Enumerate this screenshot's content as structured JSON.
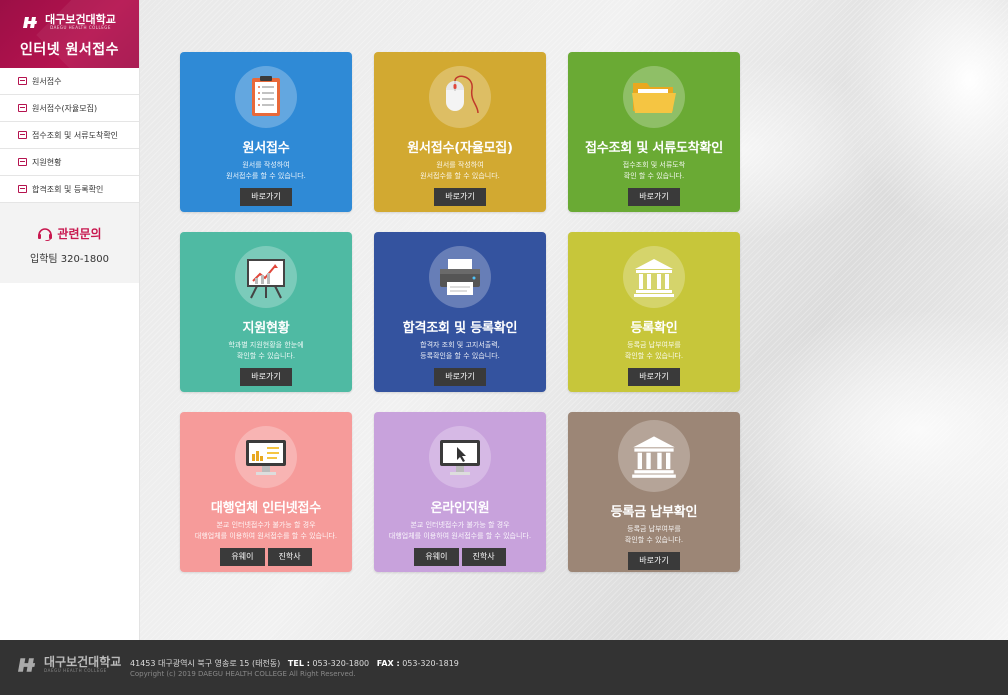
{
  "sidebar": {
    "logo_text": "대구보건대학교",
    "logo_sub": "DAEGU HEALTH COLLEGE",
    "title": "인터넷 원서접수",
    "menu": [
      {
        "label": "원서접수"
      },
      {
        "label": "원서접수(자율모집)"
      },
      {
        "label": "접수조회 및 서류도착확인"
      },
      {
        "label": "지원현황"
      },
      {
        "label": "합격조회 및 등록확인"
      }
    ],
    "contact_title": "관련문의",
    "contact_phone": "입학팀 320-1800"
  },
  "cards": [
    {
      "title": "원서접수",
      "desc1": "원서를 작성하여",
      "desc2": "원서접수를 할 수 있습니다.",
      "button": "바로가기",
      "color": "#2f8ad6",
      "icon": "clipboard-icon"
    },
    {
      "title": "원서접수(자율모집)",
      "desc1": "원서를 작성하여",
      "desc2": "원서접수를 할 수 있습니다.",
      "button": "바로가기",
      "color": "#d2a931",
      "icon": "mouse-icon"
    },
    {
      "title": "접수조회 및 서류도착확인",
      "desc1": "접수조회 및 서류도착",
      "desc2": "확인 할 수 있습니다.",
      "button": "바로가기",
      "color": "#6aaa34",
      "icon": "folder-icon"
    },
    {
      "title": "지원현황",
      "desc1": "학과별 지원현황을 한눈에",
      "desc2": "확인할 수 있습니다.",
      "button": "바로가기",
      "color": "#4fbaa3",
      "icon": "presentation-chart-icon"
    },
    {
      "title": "합격조회 및 등록확인",
      "desc1": "합격자 조회 및 고지서출력,",
      "desc2": "등록확인을 할 수 있습니다.",
      "button": "바로가기",
      "color": "#34539f",
      "icon": "printer-icon"
    },
    {
      "title": "등록확인",
      "desc1": "등록금 납부여부를",
      "desc2": "확인할 수 있습니다.",
      "button": "바로가기",
      "color": "#c7c63a",
      "icon": "bank-icon"
    },
    {
      "title": "대행업체 인터넷접수",
      "desc1": "본교 인터넷접수가 불가능 할 경우",
      "desc2": "대행업체를 이용하여 원서접수를 할 수 있습니다.",
      "button1": "유웨이",
      "button2": "진학사",
      "color": "#f69b9a",
      "icon": "monitor-chart-icon"
    },
    {
      "title": "온라인지원",
      "desc1": "본교 인터넷접수가 불가능 할 경우",
      "desc2": "대행업체를 이용하여 원서접수를 할 수 있습니다.",
      "button1": "유웨이",
      "button2": "진학사",
      "color": "#c8a2dc",
      "icon": "monitor-cursor-icon"
    },
    {
      "title": "등록금 납부확인",
      "desc1": "등록금 납부여부를",
      "desc2": "확인할 수 있습니다.",
      "button": "바로가기",
      "color": "#9c8676",
      "icon": "bank-icon"
    }
  ],
  "footer": {
    "logo_text": "대구보건대학교",
    "logo_sub": "DAEGU HEALTH COLLEGE",
    "address": "41453 대구광역시 북구 영송로 15 (태전동)",
    "tel_label": "TEL :",
    "tel": "053-320-1800",
    "fax_label": "FAX :",
    "fax": "053-320-1819",
    "copyright": "Copyright (c) 2019 DAEGU HEALTH COLLEGE All Right Reserved."
  }
}
